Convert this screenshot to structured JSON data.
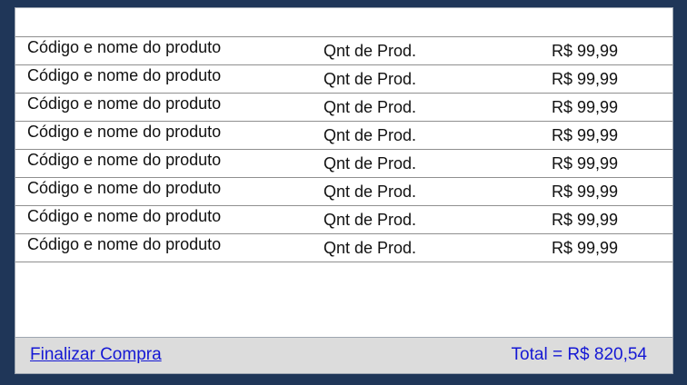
{
  "cart": {
    "items": [
      {
        "name": "Código e nome do produto",
        "quantity": "Qnt de Prod.",
        "price": "R$ 99,99"
      },
      {
        "name": "Código e nome do produto",
        "quantity": "Qnt de Prod.",
        "price": "R$ 99,99"
      },
      {
        "name": "Código e nome do produto",
        "quantity": "Qnt de Prod.",
        "price": "R$ 99,99"
      },
      {
        "name": "Código e nome do produto",
        "quantity": "Qnt de Prod.",
        "price": "R$ 99,99"
      },
      {
        "name": "Código e nome do produto",
        "quantity": "Qnt de Prod.",
        "price": "R$ 99,99"
      },
      {
        "name": "Código e nome do produto",
        "quantity": "Qnt de Prod.",
        "price": "R$ 99,99"
      },
      {
        "name": "Código e nome do produto",
        "quantity": "Qnt de Prod.",
        "price": "R$ 99,99"
      },
      {
        "name": "Código e nome do produto",
        "quantity": "Qnt de Prod.",
        "price": "R$ 99,99"
      }
    ]
  },
  "footer": {
    "finish_label": "Finalizar Compra",
    "total_label": "Total = R$ 820,54"
  },
  "colors": {
    "background": "#1f3658",
    "link": "#1518d4",
    "footer": "#dcdcdc"
  }
}
